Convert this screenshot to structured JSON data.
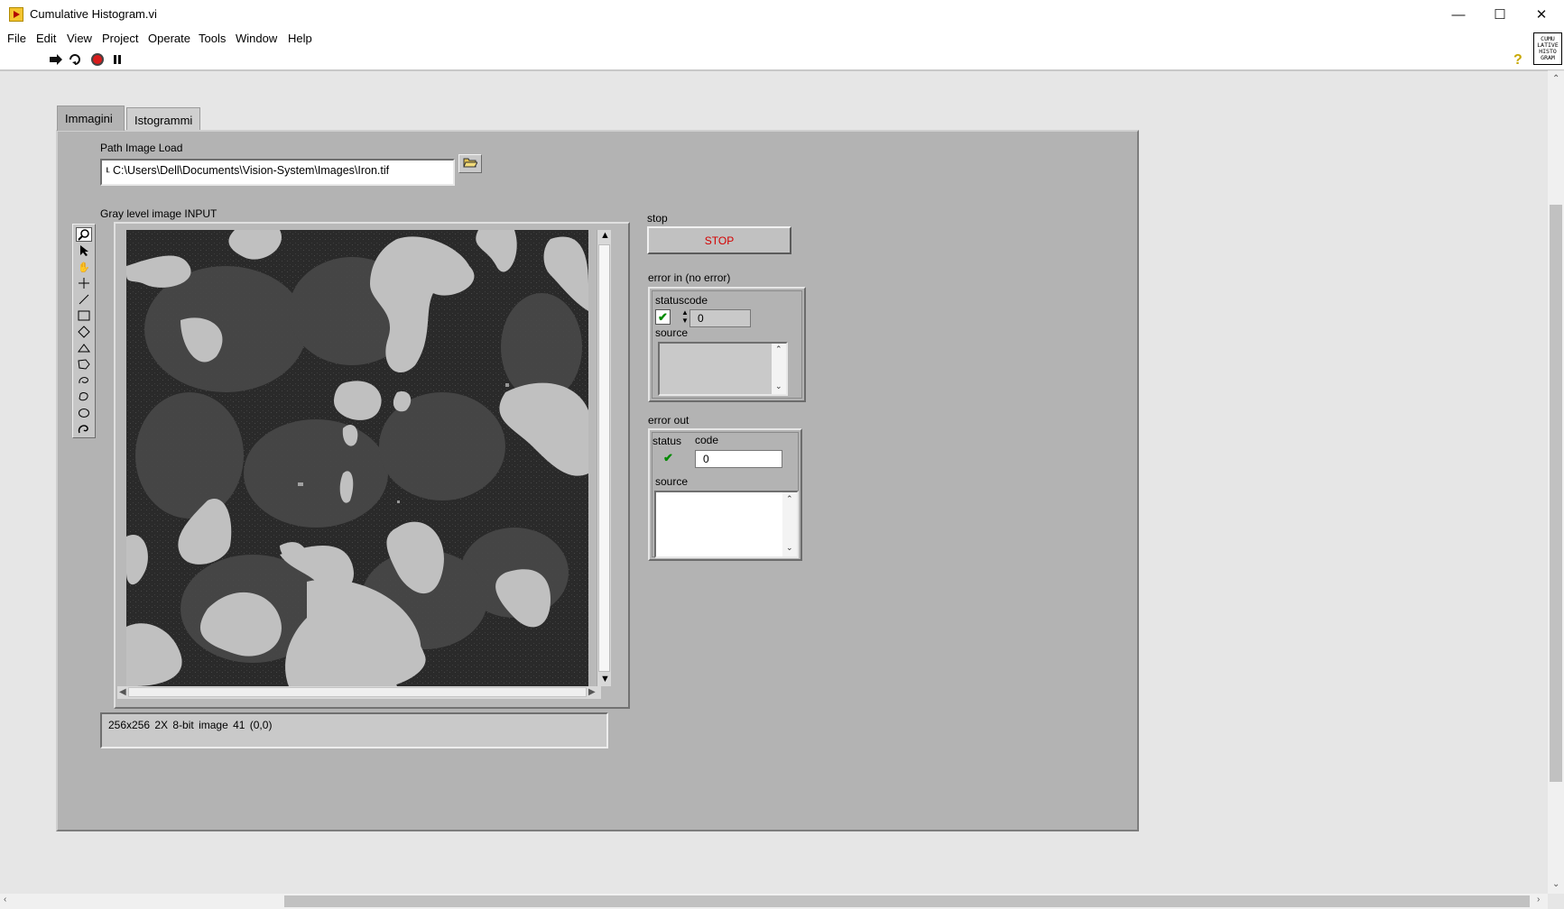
{
  "window": {
    "title": "Cumulative Histogram.vi",
    "minimize_glyph": "—",
    "maximize_glyph": "☐",
    "close_glyph": "✕"
  },
  "menu": [
    "File",
    "Edit",
    "View",
    "Project",
    "Operate",
    "Tools",
    "Window",
    "Help"
  ],
  "toolbar": {
    "icons": [
      "run-arrow-icon",
      "run-continuously-icon",
      "abort-icon",
      "pause-icon"
    ],
    "help_glyph": "?",
    "vi_icon_text": "CUMU\nLATIVE\nHISTO\nGRAM"
  },
  "tabs": [
    {
      "label": "Immagini",
      "active": true
    },
    {
      "label": "Istogrammi",
      "active": false
    }
  ],
  "path_control": {
    "label": "Path Image Load",
    "value": "C:\\Users\\Dell\\Documents\\Vision-System\\Images\\Iron.tif"
  },
  "image_display": {
    "label": "Gray level image INPUT",
    "status_text": "256x256 2X 8-bit image 41    (0,0)",
    "tools": [
      "zoom-icon",
      "pointer-icon",
      "pan-icon",
      "crosshair-icon",
      "line-icon",
      "rectangle-icon",
      "rotated-rectangle-icon",
      "annulus-icon",
      "polygon-icon",
      "freehand-icon",
      "free-region-icon",
      "oval-icon",
      "broken-line-icon"
    ]
  },
  "stop": {
    "label": "stop",
    "button_text": "STOP"
  },
  "error_in": {
    "label": "error in (no error)",
    "status_label": "status",
    "code_label": "code",
    "code_value": "0",
    "source_label": "source",
    "source_value": ""
  },
  "error_out": {
    "label": "error out",
    "status_label": "status",
    "code_label": "code",
    "code_value": "0",
    "source_label": "source",
    "source_value": ""
  }
}
